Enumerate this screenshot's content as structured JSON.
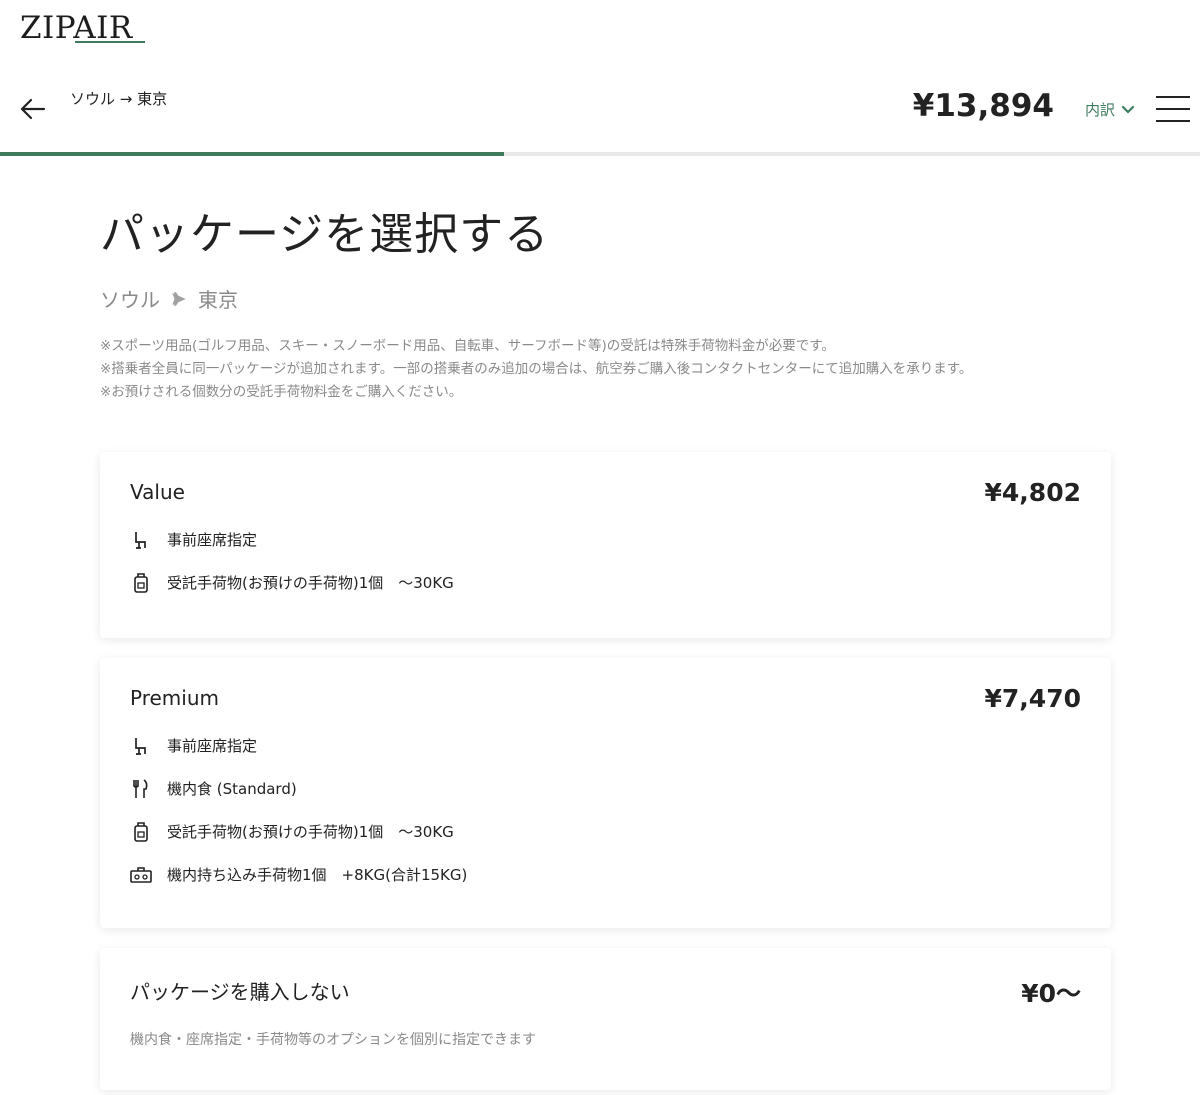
{
  "brand": {
    "logo_text": "ZIPAIR"
  },
  "header": {
    "route": "ソウル → 東京",
    "total_price": "¥13,894",
    "breakdown_label": "内訳"
  },
  "progress": {
    "fraction": 0.42
  },
  "page": {
    "title": "パッケージを選択する",
    "route_from": "ソウル",
    "route_to": "東京",
    "notes": [
      "※スポーツ用品(ゴルフ用品、スキー・スノーボード用品、自転車、サーフボード等)の受託は特殊手荷物料金が必要です。",
      "※搭乗者全員に同一パッケージが追加されます。一部の搭乗者のみ追加の場合は、航空券ご購入後コンタクトセンターにて追加購入を承ります。",
      "※お預けされる個数分の受託手荷物料金をご購入ください。"
    ]
  },
  "packages": [
    {
      "name": "Value",
      "price": "¥4,802",
      "features": [
        {
          "icon": "seat-icon",
          "text": "事前座席指定"
        },
        {
          "icon": "luggage-icon",
          "text": "受託手荷物(お預けの手荷物)1個　～30KG"
        }
      ]
    },
    {
      "name": "Premium",
      "price": "¥7,470",
      "features": [
        {
          "icon": "seat-icon",
          "text": "事前座席指定"
        },
        {
          "icon": "meal-icon",
          "text": "機内食 (Standard)"
        },
        {
          "icon": "luggage-icon",
          "text": "受託手荷物(お預けの手荷物)1個　～30KG"
        },
        {
          "icon": "carry-on-bag-icon",
          "text": "機内持ち込み手荷物1個　+8KG(合計15KG)"
        }
      ]
    },
    {
      "name": "パッケージを購入しない",
      "price": "¥0～",
      "description": "機内食・座席指定・手荷物等のオプションを個別に指定できます"
    }
  ],
  "colors": {
    "accent": "#3e7a5e",
    "muted_text": "#8a8a8a"
  }
}
